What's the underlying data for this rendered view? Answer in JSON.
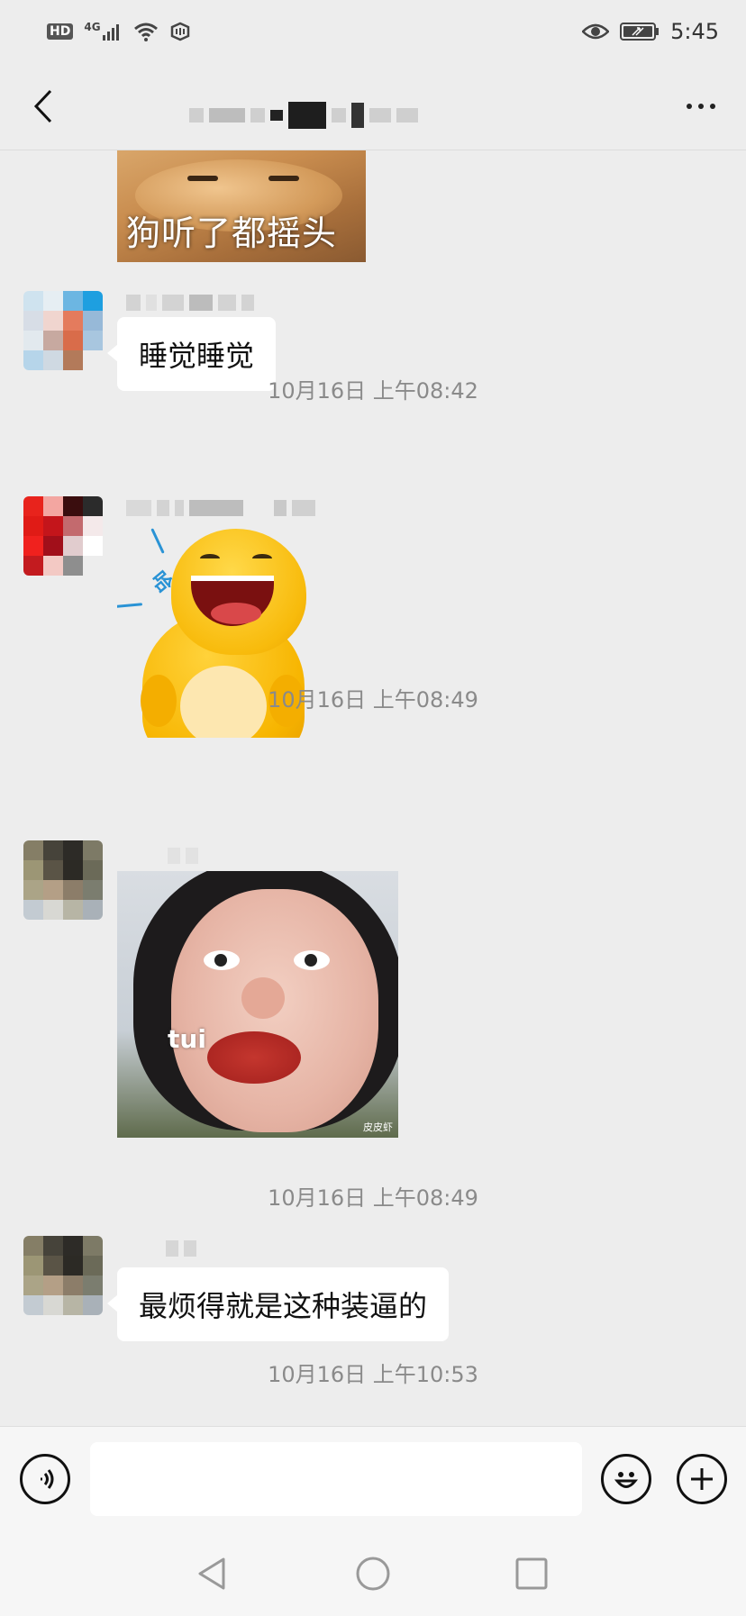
{
  "status_bar": {
    "hd_badge": "HD",
    "network": "4G",
    "time": "5:45"
  },
  "header": {
    "title": ""
  },
  "messages": [
    {
      "type": "sticker",
      "caption": "狗听了都摇头"
    },
    {
      "type": "text",
      "text": "睡觉睡觉"
    },
    {
      "type": "timestamp",
      "text": "10月16日 上午08:42"
    },
    {
      "type": "sticker",
      "caption": "哈"
    },
    {
      "type": "timestamp",
      "text": "10月16日 上午08:49"
    },
    {
      "type": "sticker",
      "caption": "tui",
      "watermark": "皮皮虾"
    },
    {
      "type": "timestamp",
      "text": "10月16日 上午08:49"
    },
    {
      "type": "text",
      "text": "最烦得就是这种装逼的"
    },
    {
      "type": "timestamp",
      "text": "10月16日 上午10:53"
    }
  ],
  "input": {
    "value": "",
    "placeholder": ""
  },
  "icons": {
    "back": "back-chevron-icon",
    "more": "more-dots-icon",
    "voice": "voice-icon",
    "emoji": "emoji-icon",
    "plus": "plus-icon",
    "nav_back": "triangle-back-icon",
    "nav_home": "circle-home-icon",
    "nav_recent": "square-recent-icon"
  },
  "colors": {
    "background": "#ededed",
    "bubble": "#ffffff",
    "timestamp_text": "#8a8a8a"
  }
}
